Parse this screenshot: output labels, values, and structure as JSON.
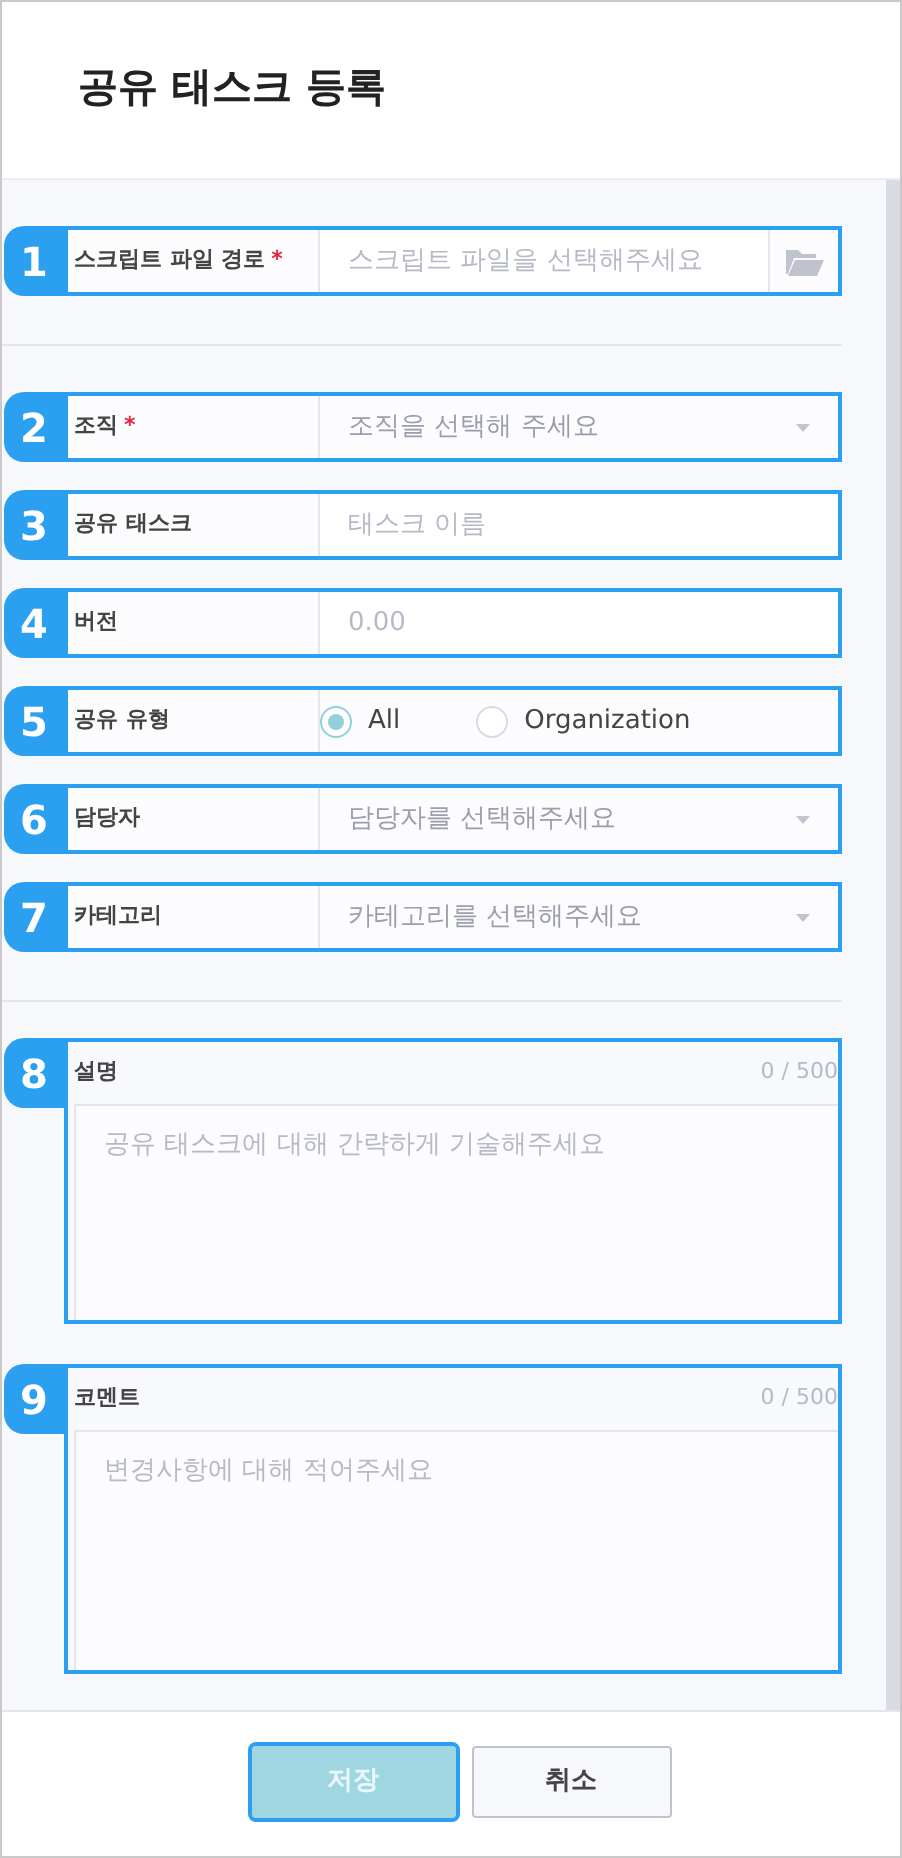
{
  "title": "공유 태스크 등록",
  "sections": [
    {
      "fields": [
        {
          "kind": "file",
          "marker": "1",
          "label": "스크립트 파일 경로",
          "required_mark": "*",
          "placeholder": "스크립트 파일을 선택해주세요"
        }
      ]
    },
    {
      "fields": [
        {
          "kind": "select",
          "marker": "2",
          "label": "조직",
          "required_mark": "*",
          "placeholder": "조직을 선택해 주세요"
        },
        {
          "kind": "text",
          "marker": "3",
          "label": "공유 태스크",
          "placeholder": "태스크 이름"
        },
        {
          "kind": "text",
          "marker": "4",
          "label": "버전",
          "placeholder": "0.00"
        },
        {
          "kind": "radio",
          "marker": "5",
          "label": "공유 유형",
          "options": [
            {
              "label": "All",
              "selected": true
            },
            {
              "label": "Organization",
              "selected": false
            }
          ]
        },
        {
          "kind": "select",
          "marker": "6",
          "label": "담당자",
          "placeholder": "담당자를 선택해주세요"
        },
        {
          "kind": "select",
          "marker": "7",
          "label": "카테고리",
          "placeholder": "카테고리를 선택해주세요"
        }
      ]
    },
    {
      "fields": [
        {
          "kind": "textarea",
          "marker": "8",
          "label": "설명",
          "counter": "0 / 500",
          "placeholder": "공유 태스크에 대해 간략하게 기술해주세요"
        },
        {
          "kind": "textarea",
          "marker": "9",
          "label": "코멘트",
          "counter": "0 / 500",
          "placeholder": "변경사항에 대해 적어주세요"
        }
      ]
    }
  ],
  "buttons": [
    {
      "label": "저장",
      "kind": "primary",
      "disabled": true,
      "highlighted": true
    },
    {
      "label": "취소",
      "kind": "secondary",
      "disabled": false,
      "highlighted": false
    }
  ]
}
